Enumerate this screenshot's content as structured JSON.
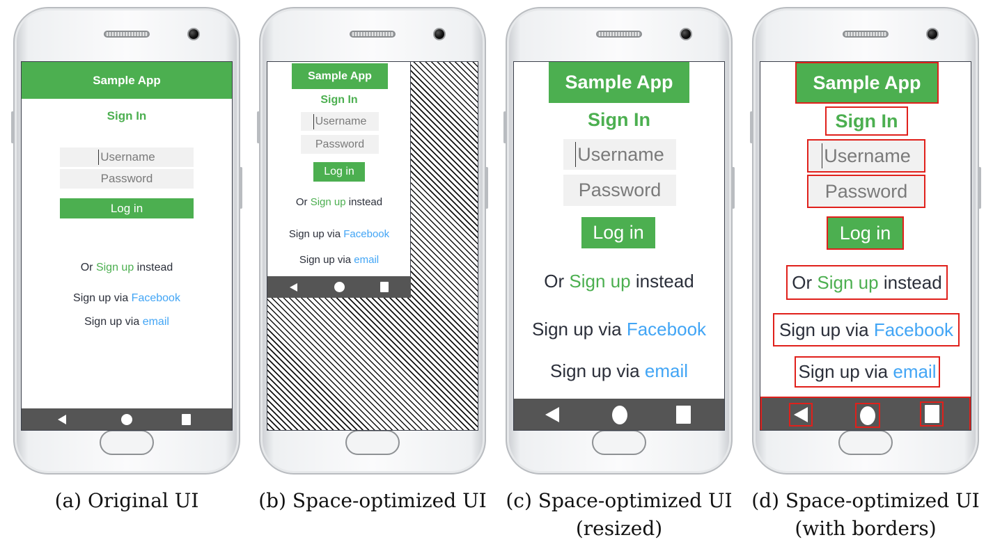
{
  "app": {
    "title": "Sample App",
    "heading": "Sign In",
    "username_placeholder": "Username",
    "password_placeholder": "Password",
    "login_label": "Log in",
    "or_prefix": "Or",
    "signup_link": "Sign up",
    "or_suffix": "instead",
    "facebook_prefix": "Sign up via",
    "facebook_link": "Facebook",
    "email_prefix": "Sign up via",
    "email_link": "email"
  },
  "nav_icons": [
    "back-icon",
    "home-icon",
    "recents-icon"
  ],
  "colors": {
    "brand_green": "#4caf50",
    "link_blue": "#42a5f5",
    "nav_bar": "#555555",
    "border_red": "#e0201b"
  },
  "captions": {
    "a": "(a) Original UI",
    "b": "(b) Space-optimized UI",
    "c_line1": "(c) Space-optimized UI",
    "c_line2": "(resized)",
    "d_line1": "(d) Space-optimized UI",
    "d_line2": "(with borders)"
  }
}
